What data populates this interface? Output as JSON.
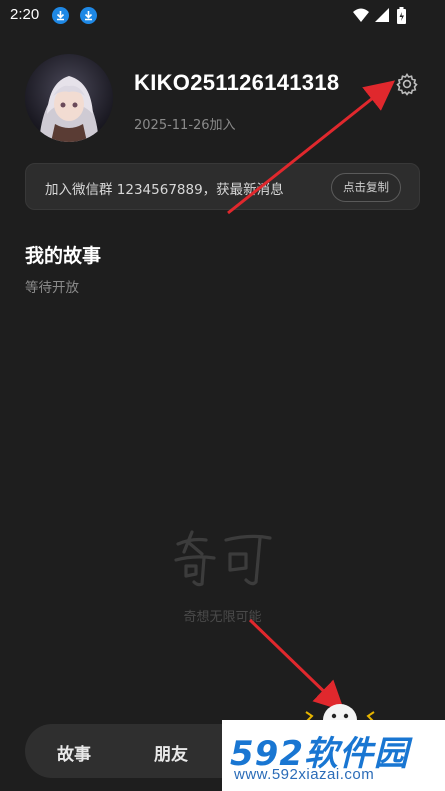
{
  "status_bar": {
    "time": "2:20",
    "icons": [
      "download-icon",
      "download-icon",
      "wifi-icon",
      "signal-icon",
      "battery-icon"
    ]
  },
  "profile": {
    "username": "KIKO251126141318",
    "joined": "2025-11-26加入",
    "settings_icon": "gear-icon"
  },
  "banner": {
    "text": "加入微信群 1234567889，获最新消息",
    "copy_label": "点击复制"
  },
  "story": {
    "title": "我的故事",
    "subtitle": "等待开放"
  },
  "brand": {
    "logo_text": "奇可",
    "slogan": "奇想无限可能"
  },
  "bottom_nav": {
    "items": [
      {
        "label": "故事"
      },
      {
        "label": "朋友"
      }
    ]
  },
  "watermark": {
    "logo": "592软件园",
    "url": "www.592xiazai.com"
  },
  "colors": {
    "background": "#1e1e1e",
    "accent_arrow": "#e0282d",
    "watermark_blue": "#1976d2"
  }
}
